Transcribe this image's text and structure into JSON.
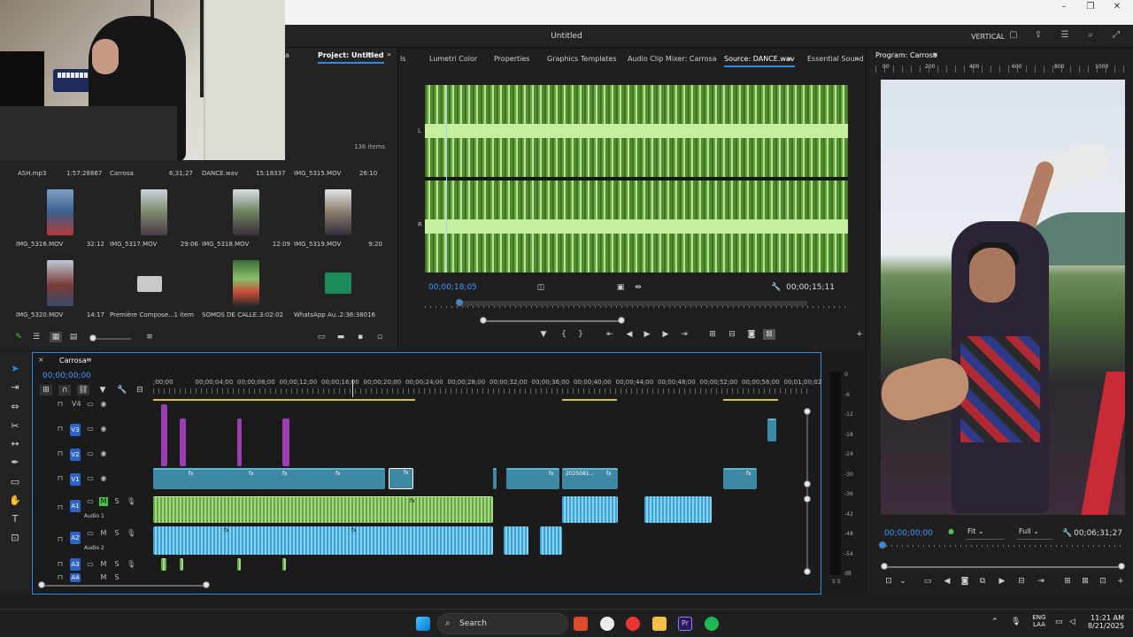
{
  "window": {
    "title": "Untitled",
    "layout_label": "VERTICAL",
    "minimize": "–",
    "restore": "❐",
    "close": "✕"
  },
  "project": {
    "tab_prev": "a",
    "tab": "Project: Untitled",
    "item_count": "136 items",
    "row0": [
      {
        "name": "ASH.mp3",
        "duration": "1:57:28867"
      },
      {
        "name": "Carrosa",
        "duration": "6;31;27"
      },
      {
        "name": "DANCE.wav",
        "duration": "15:18337"
      },
      {
        "name": "IMG_5315.MOV",
        "duration": "26:10"
      }
    ],
    "row1": [
      {
        "name": "IMG_5316.MOV",
        "duration": "32:12"
      },
      {
        "name": "IMG_5317.MOV",
        "duration": "29:06"
      },
      {
        "name": "IMG_5318.MOV",
        "duration": "12:09"
      },
      {
        "name": "IMG_5319.MOV",
        "duration": "9:20"
      }
    ],
    "row2": [
      {
        "name": "IMG_5320.MOV",
        "duration": "14:17"
      },
      {
        "name": "Première Compose...",
        "duration": "1 item"
      },
      {
        "name": "SOMOS DE CALLE...",
        "duration": "3:02:02"
      },
      {
        "name": "WhatsApp Au...",
        "duration": "2:36:38016"
      }
    ]
  },
  "source": {
    "tabs": [
      "ls",
      "Lumetri Color",
      "Properties",
      "Graphics Templates",
      "Audio Clip Mixer: Carrosa",
      "Source: DANCE.wav",
      "Essential Sound"
    ],
    "active_tab": "Source: DANCE.wav",
    "channel_left": "L",
    "channel_right": "R",
    "timecode": "00;00;18;05",
    "duration": "00;00;15;11",
    "playhead_fraction": 0.05
  },
  "program": {
    "title": "Program: Carrosa",
    "timecode": "00;00;00;00",
    "fit": "Fit",
    "quality": "Full",
    "duration": "00;06;31;27",
    "ruler": [
      "00",
      "200",
      "400",
      "600",
      "800",
      "1000"
    ]
  },
  "timeline": {
    "sequence": "Carrosa",
    "timecode": "00;00;00;00",
    "ruler": [
      ";00;00",
      "00;00;04;00",
      "00;00;08;00",
      "00;00;12;00",
      "00;00;16;00",
      "00;00;20;00",
      "00;00;24;00",
      "00;00;28;00",
      "00;00;32;00",
      "00;00;36;00",
      "00;00;40;00",
      "00;00;44;00",
      "00;00;48;00",
      "00;00;52;00",
      "00;00;56;00",
      "00;01;00;02"
    ],
    "tracks": [
      {
        "id": "V4",
        "name": ""
      },
      {
        "id": "V3",
        "name": ""
      },
      {
        "id": "V2",
        "name": ""
      },
      {
        "id": "V1",
        "name": ""
      },
      {
        "id": "A1",
        "name": "Audio 1"
      },
      {
        "id": "A2",
        "name": "Audio 2"
      },
      {
        "id": "A3",
        "name": ""
      },
      {
        "id": "A4",
        "name": ""
      }
    ],
    "clip_label": "2025081...",
    "fx": "fx",
    "m": "M",
    "s": "S"
  },
  "meter": {
    "labels": [
      "0",
      "-6",
      "-12",
      "-18",
      "-24",
      "-30",
      "-36",
      "-42",
      "-48",
      "-54",
      "dB"
    ],
    "bottom": "S S"
  },
  "taskbar": {
    "search": "Search",
    "lang_top": "ENG",
    "lang_bottom": "LAA",
    "time": "11:21 AM",
    "date": "8/21/2025"
  },
  "colors": {
    "accent": "#2d8ceb",
    "timecode": "#3f9bff",
    "video_clip": "#3d88a5",
    "purple_clip": "#9c3fb5",
    "audio_green": "#a3d07c",
    "audio_blue": "#3aa3d5"
  }
}
